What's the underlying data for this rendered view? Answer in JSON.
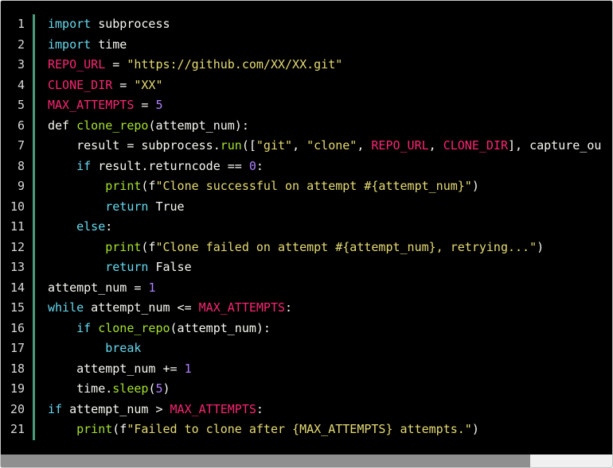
{
  "editor": {
    "lines": [
      {
        "no": "1",
        "tokens": [
          {
            "t": "import",
            "c": "kw"
          },
          {
            "t": " subprocess",
            "c": "plain"
          }
        ]
      },
      {
        "no": "2",
        "tokens": [
          {
            "t": "import",
            "c": "kw"
          },
          {
            "t": " time",
            "c": "plain"
          }
        ]
      },
      {
        "no": "3",
        "tokens": [
          {
            "t": "REPO_URL",
            "c": "const"
          },
          {
            "t": " = ",
            "c": "plain"
          },
          {
            "t": "\"https://github.com/XX/XX.git\"",
            "c": "str"
          }
        ]
      },
      {
        "no": "4",
        "tokens": [
          {
            "t": "CLONE_DIR",
            "c": "const"
          },
          {
            "t": " = ",
            "c": "plain"
          },
          {
            "t": "\"XX\"",
            "c": "str"
          }
        ]
      },
      {
        "no": "5",
        "tokens": [
          {
            "t": "MAX_ATTEMPTS",
            "c": "const"
          },
          {
            "t": " = ",
            "c": "plain"
          },
          {
            "t": "5",
            "c": "num"
          }
        ]
      },
      {
        "no": "6",
        "tokens": [
          {
            "t": "def ",
            "c": "plain"
          },
          {
            "t": "clone_repo",
            "c": "fn"
          },
          {
            "t": "(attempt_num):",
            "c": "plain"
          }
        ]
      },
      {
        "no": "7",
        "tokens": [
          {
            "t": "    result = subprocess.",
            "c": "plain"
          },
          {
            "t": "run",
            "c": "fn"
          },
          {
            "t": "([",
            "c": "plain"
          },
          {
            "t": "\"git\"",
            "c": "str"
          },
          {
            "t": ", ",
            "c": "plain"
          },
          {
            "t": "\"clone\"",
            "c": "str"
          },
          {
            "t": ", ",
            "c": "plain"
          },
          {
            "t": "REPO_URL",
            "c": "const"
          },
          {
            "t": ", ",
            "c": "plain"
          },
          {
            "t": "CLONE_DIR",
            "c": "const"
          },
          {
            "t": "], capture_ou",
            "c": "plain"
          }
        ]
      },
      {
        "no": "8",
        "tokens": [
          {
            "t": "    ",
            "c": "plain"
          },
          {
            "t": "if",
            "c": "kw"
          },
          {
            "t": " result.returncode == ",
            "c": "plain"
          },
          {
            "t": "0",
            "c": "num"
          },
          {
            "t": ":",
            "c": "plain"
          }
        ]
      },
      {
        "no": "9",
        "tokens": [
          {
            "t": "        ",
            "c": "plain"
          },
          {
            "t": "print",
            "c": "fn"
          },
          {
            "t": "(f",
            "c": "plain"
          },
          {
            "t": "\"Clone successful on attempt #{attempt_num}\"",
            "c": "str"
          },
          {
            "t": ")",
            "c": "plain"
          }
        ]
      },
      {
        "no": "10",
        "tokens": [
          {
            "t": "        ",
            "c": "plain"
          },
          {
            "t": "return",
            "c": "kw"
          },
          {
            "t": " True",
            "c": "plain"
          }
        ]
      },
      {
        "no": "11",
        "tokens": [
          {
            "t": "    ",
            "c": "plain"
          },
          {
            "t": "else",
            "c": "kw"
          },
          {
            "t": ":",
            "c": "plain"
          }
        ]
      },
      {
        "no": "12",
        "tokens": [
          {
            "t": "        ",
            "c": "plain"
          },
          {
            "t": "print",
            "c": "fn"
          },
          {
            "t": "(f",
            "c": "plain"
          },
          {
            "t": "\"Clone failed on attempt #{attempt_num}, retrying...\"",
            "c": "str"
          },
          {
            "t": ")",
            "c": "plain"
          }
        ]
      },
      {
        "no": "13",
        "tokens": [
          {
            "t": "        ",
            "c": "plain"
          },
          {
            "t": "return",
            "c": "kw"
          },
          {
            "t": " False",
            "c": "plain"
          }
        ]
      },
      {
        "no": "14",
        "tokens": [
          {
            "t": "attempt_num = ",
            "c": "plain"
          },
          {
            "t": "1",
            "c": "num"
          }
        ]
      },
      {
        "no": "15",
        "tokens": [
          {
            "t": "while",
            "c": "kw"
          },
          {
            "t": " attempt_num <= ",
            "c": "plain"
          },
          {
            "t": "MAX_ATTEMPTS",
            "c": "const"
          },
          {
            "t": ":",
            "c": "plain"
          }
        ]
      },
      {
        "no": "16",
        "tokens": [
          {
            "t": "    ",
            "c": "plain"
          },
          {
            "t": "if",
            "c": "kw"
          },
          {
            "t": " ",
            "c": "plain"
          },
          {
            "t": "clone_repo",
            "c": "fn"
          },
          {
            "t": "(attempt_num):",
            "c": "plain"
          }
        ]
      },
      {
        "no": "17",
        "tokens": [
          {
            "t": "        ",
            "c": "plain"
          },
          {
            "t": "break",
            "c": "kw"
          }
        ]
      },
      {
        "no": "18",
        "tokens": [
          {
            "t": "    attempt_num += ",
            "c": "plain"
          },
          {
            "t": "1",
            "c": "num"
          }
        ]
      },
      {
        "no": "19",
        "tokens": [
          {
            "t": "    time.",
            "c": "plain"
          },
          {
            "t": "sleep",
            "c": "fn"
          },
          {
            "t": "(",
            "c": "plain"
          },
          {
            "t": "5",
            "c": "num"
          },
          {
            "t": ")",
            "c": "plain"
          }
        ]
      },
      {
        "no": "20",
        "tokens": [
          {
            "t": "if",
            "c": "kw"
          },
          {
            "t": " attempt_num > ",
            "c": "plain"
          },
          {
            "t": "MAX_ATTEMPTS",
            "c": "const"
          },
          {
            "t": ":",
            "c": "plain"
          }
        ]
      },
      {
        "no": "21",
        "tokens": [
          {
            "t": "    ",
            "c": "plain"
          },
          {
            "t": "print",
            "c": "fn"
          },
          {
            "t": "(f",
            "c": "plain"
          },
          {
            "t": "\"Failed to clone after {MAX_ATTEMPTS} attempts.\"",
            "c": "str"
          },
          {
            "t": ")",
            "c": "plain"
          }
        ]
      }
    ],
    "scroll_fraction": 0.866
  },
  "colors": {
    "background": "#000000",
    "keyword": "#66d9ef",
    "constant": "#f92672",
    "string": "#e6db74",
    "number": "#ae81ff",
    "function": "#a6e22e",
    "gutter_bar": "#4a9d7a"
  }
}
